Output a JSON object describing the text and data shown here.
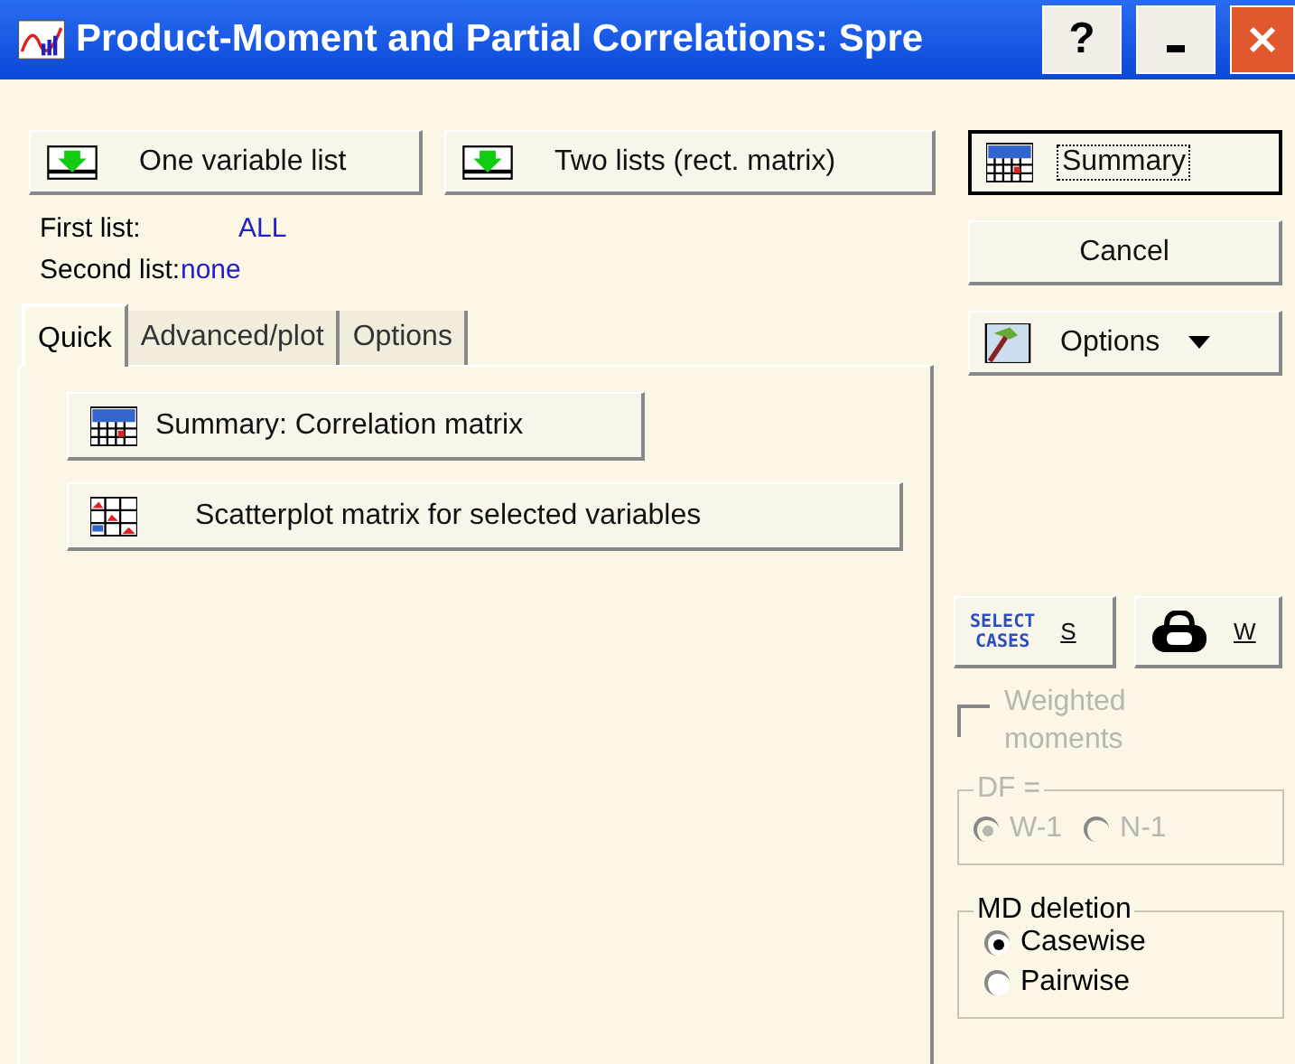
{
  "window": {
    "title": "Product-Moment and Partial Correlations: Spre",
    "controls": [
      "?"
    ]
  },
  "list_buttons": [
    {
      "label": "One variable list"
    },
    {
      "label": "Two lists (rect. matrix)"
    }
  ],
  "lists": [
    {
      "label": "First list:",
      "value": "ALL"
    },
    {
      "label": "Second list:",
      "value": "none"
    }
  ],
  "tabs": [
    {
      "label": "Quick",
      "selected": true
    },
    {
      "label": "Advanced/plot",
      "selected": false
    },
    {
      "label": "Options",
      "selected": false
    }
  ],
  "quick_buttons": [
    {
      "kind": "summary",
      "label": "Summary:  Correlation matrix"
    },
    {
      "kind": "scatter",
      "label": "Scatterplot matrix for selected variables"
    }
  ],
  "side_buttons": [
    {
      "kind": "summary",
      "label": "Summary",
      "default": true
    },
    {
      "kind": "plain",
      "label": "Cancel",
      "default": false
    },
    {
      "kind": "options",
      "label": "Options",
      "default": false
    }
  ],
  "select_cases": {
    "icon_text": [
      "SELECT",
      "CASES"
    ],
    "key": "S"
  },
  "weight": {
    "key": "W"
  },
  "weighted_moments": {
    "label": "Weighted moments",
    "checked": false,
    "disabled": true
  },
  "df_group": {
    "title": "DF =",
    "disabled": true,
    "options": [
      {
        "label": "W-1",
        "selected": true
      },
      {
        "label": "N-1",
        "selected": false
      }
    ]
  },
  "md_group": {
    "title": "MD deletion",
    "options": [
      {
        "label": "Casewise",
        "selected": true
      },
      {
        "label": "Pairwise",
        "selected": false
      }
    ]
  }
}
